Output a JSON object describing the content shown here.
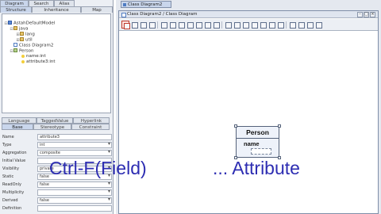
{
  "top_tabs": [
    "Diagram",
    "Search",
    "Alias"
  ],
  "sub_tabs": [
    "Structure",
    "Inheritance",
    "Map"
  ],
  "tree": [
    {
      "label": "AstahDefaultModel",
      "icon": "model-icon",
      "expander": "⊟"
    },
    {
      "label": "java",
      "icon": "package-icon",
      "expander": "⊟"
    },
    {
      "label": "lang",
      "icon": "package-icon",
      "expander": "⊞"
    },
    {
      "label": "util",
      "icon": "package-icon",
      "expander": "⊞"
    },
    {
      "label": "Class Diagram2",
      "icon": "diagram-icon",
      "expander": ""
    },
    {
      "label": "Person",
      "icon": "class-icon",
      "expander": "⊟"
    },
    {
      "label": "name:int",
      "icon": "attribute-icon",
      "expander": ""
    },
    {
      "label": "attribute3:int",
      "icon": "attribute-icon",
      "expander": ""
    }
  ],
  "prop_tabs_row1": [
    "Language",
    "TaggedValue",
    "Hyperlink"
  ],
  "prop_tabs_row2": [
    "Base",
    "Stereotype",
    "Constraint"
  ],
  "props": [
    {
      "label": "Name",
      "value": "attribute3",
      "select": false
    },
    {
      "label": "Type",
      "value": "int",
      "select": true
    },
    {
      "label": "Aggregation",
      "value": "composite",
      "select": true
    },
    {
      "label": "Initial Value",
      "value": "",
      "select": false
    },
    {
      "label": "Visibility",
      "value": "private",
      "select": true
    },
    {
      "label": "Static",
      "value": "false",
      "select": true
    },
    {
      "label": "ReadOnly",
      "value": "false",
      "select": true
    },
    {
      "label": "Multiplicity",
      "value": "",
      "select": true
    },
    {
      "label": "Derived",
      "value": "false",
      "select": true
    },
    {
      "label": "Definition",
      "value": "",
      "select": false
    }
  ],
  "doc_tab": "Class Diagram2",
  "breadcrumb": "Class Diagram2 / Class Diagram",
  "window_buttons": [
    "–",
    "□",
    "×"
  ],
  "uml_class": {
    "name": "Person",
    "attribute": "name"
  },
  "caption": {
    "left": "Ctrl-F(Field)",
    "right": "... Attribute"
  },
  "colors": {
    "caption": "#2d2db2",
    "selected_tool": "#c0392b"
  }
}
